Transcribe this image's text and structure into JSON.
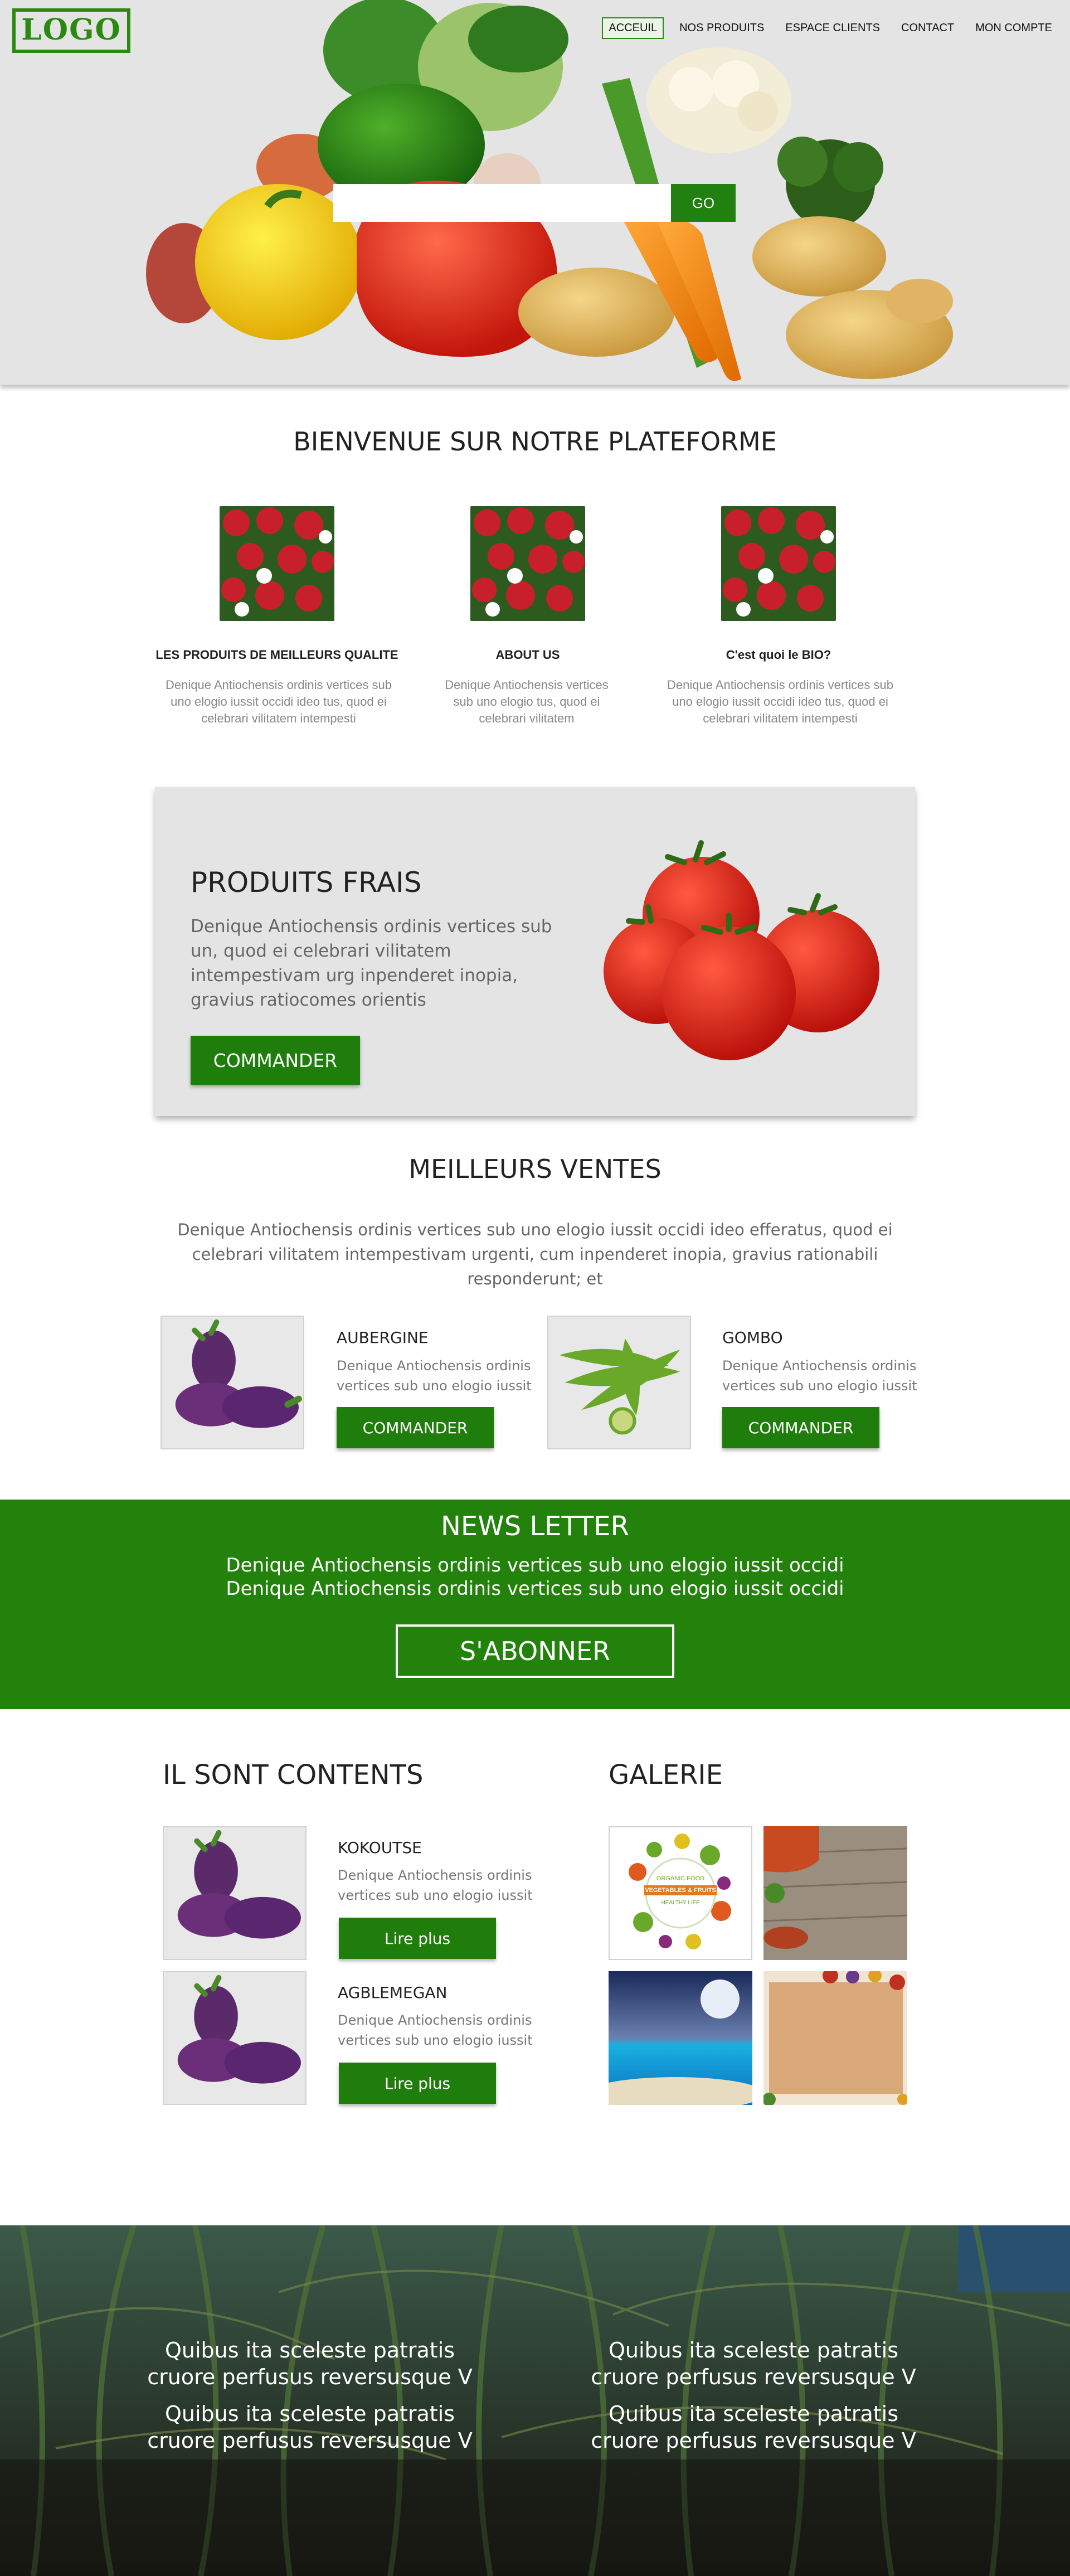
{
  "brand": {
    "logo": "LOGO",
    "accent": "#1f7d0c"
  },
  "nav": {
    "items": [
      "ACCEUIL",
      "NOS PRODUITS",
      "ESPACE CLIENTS",
      "CONTACT",
      "MON COMPTE"
    ],
    "active": "ACCEUIL"
  },
  "search": {
    "value": "",
    "placeholder": "",
    "button": "GO"
  },
  "welcome": {
    "title": "BIENVENUE SUR NOTRE PLATEFORME",
    "features": [
      {
        "title": "LES PRODUITS DE MEILLEURS  QUALITE",
        "text": "Denique Antiochensis ordinis vertices sub uno elogio iussit occidi ideo tus, quod ei celebrari vilitatem intempesti"
      },
      {
        "title": "ABOUT US",
        "text": "Denique Antiochensis vertices sub uno elogio tus, quod ei celebrari vilitatem"
      },
      {
        "title": "C'est quoi le BIO?",
        "text": "Denique Antiochensis ordinis vertices sub uno elogio iussit occidi ideo tus, quod ei celebrari vilitatem intempesti"
      }
    ]
  },
  "promo": {
    "title": "PRODUITS FRAIS",
    "text": "Denique Antiochensis ordinis vertices sub un, quod ei celebrari vilitatem intempestivam urg inpenderet inopia, gravius ratiocomes orientis",
    "button": "COMMANDER"
  },
  "best_sellers": {
    "title": "MEILLEURS VENTES",
    "text": "Denique Antiochensis ordinis vertices sub uno elogio iussit occidi ideo efferatus, quod ei celebrari vilitatem intempestivam urgenti, cum inpenderet inopia, gravius rationabili responderunt; et",
    "products": [
      {
        "name": "AUBERGINE",
        "desc": "Denique Antiochensis ordinis vertices sub uno elogio iussit",
        "button": "COMMANDER"
      },
      {
        "name": "GOMBO",
        "desc": "Denique Antiochensis ordinis vertices sub uno elogio iussit",
        "button": "COMMANDER"
      }
    ]
  },
  "newsletter": {
    "title": "NEWS LETTER",
    "line1": "Denique Antiochensis ordinis vertices sub uno elogio iussit occidi",
    "line2": "Denique Antiochensis ordinis vertices sub uno elogio iussit occidi",
    "button": "S'ABONNER"
  },
  "testimonials": {
    "title": "IL SONT CONTENTS",
    "items": [
      {
        "name": "KOKOUTSE",
        "desc": "Denique Antiochensis ordinis vertices sub uno elogio iussit",
        "button": "Lire plus"
      },
      {
        "name": "AGBLEMEGAN",
        "desc": "Denique Antiochensis ordinis vertices sub uno elogio iussit",
        "button": "Lire plus"
      }
    ]
  },
  "gallery": {
    "title": "GALERIE",
    "badge_top": "ORGANIC FOOD",
    "badge_mid": "VEGETABLES & FRUITS",
    "badge_bottom": "HEALTHY LIFE"
  },
  "footer": {
    "left_1": "Quibus ita sceleste patratis cruore perfusus reversusque V",
    "left_2": "Quibus ita sceleste patratis cruore perfusus reversusque V",
    "right_1": "Quibus ita sceleste patratis cruore perfusus reversusque V",
    "right_2": "Quibus ita sceleste patratis cruore perfusus reversusque V"
  }
}
